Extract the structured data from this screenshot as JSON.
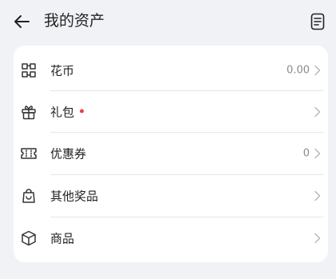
{
  "header": {
    "title": "我的资产",
    "back_icon": "arrow-left-icon",
    "bill_icon": "bill-list-icon"
  },
  "items": [
    {
      "id": "huabi",
      "label": "花币",
      "icon": "huabi-coin-icon",
      "value": "0.00",
      "dot": false
    },
    {
      "id": "gift",
      "label": "礼包",
      "icon": "gift-icon",
      "value": "",
      "dot": true
    },
    {
      "id": "coupon",
      "label": "优惠券",
      "icon": "coupon-icon",
      "value": "0",
      "dot": false
    },
    {
      "id": "other-prizes",
      "label": "其他奖品",
      "icon": "bag-icon",
      "value": "",
      "dot": false
    },
    {
      "id": "goods",
      "label": "商品",
      "icon": "package-icon",
      "value": "",
      "dot": false
    }
  ],
  "colors": {
    "background": "#f1f2f6",
    "card": "#ffffff",
    "dot": "#e84141",
    "secondary_text": "#8a8a8a"
  }
}
